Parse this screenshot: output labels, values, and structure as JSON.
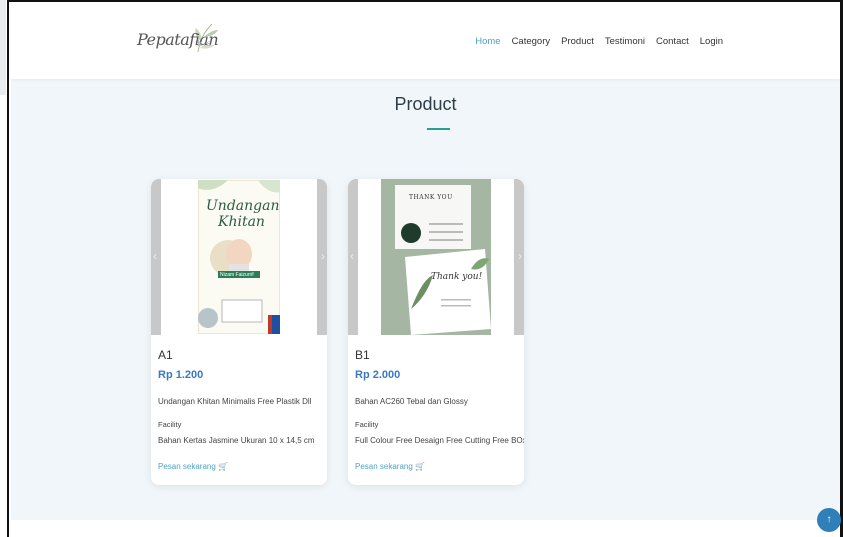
{
  "brand": {
    "logo_script": "Pepatafian",
    "logo_suffix": "h.s."
  },
  "nav": {
    "items": [
      {
        "label": "Home",
        "active": true
      },
      {
        "label": "Category"
      },
      {
        "label": "Product"
      },
      {
        "label": "Testimoni"
      },
      {
        "label": "Contact"
      },
      {
        "label": "Login"
      }
    ]
  },
  "section": {
    "title": "Product",
    "accent": "#2a9d8f"
  },
  "products": [
    {
      "code": "A1",
      "price": "Rp 1.200",
      "description": "Undangan Khitan Minimalis Free Plastik Dll",
      "facility_label": "Facility",
      "facility": "Bahan Kertas Jasmine Ukuran 10 x 14,5 cm",
      "order_label": "Pesan sekarang",
      "image_text": {
        "line1": "Undangan",
        "line2": "Khitan",
        "name": "Nizam Faizurrif"
      }
    },
    {
      "code": "B1",
      "price": "Rp 2.000",
      "description": "Bahan AC260 Tebal dan Glossy",
      "facility_label": "Facility",
      "facility": "Full Colour Free Desaign Free Cutting Free BOx",
      "order_label": "Pesan sekarang",
      "image_text": {
        "line1": "THANK YOU",
        "line2": "Thank you!"
      }
    }
  ],
  "colors": {
    "price": "#3a78c2",
    "link": "#4fa3c5",
    "page_bg": "#f0f6f9",
    "scroll_top": "#2f7fb8"
  },
  "icons": {
    "cart": "cart-icon",
    "scroll_top": "arrow-up-icon"
  }
}
